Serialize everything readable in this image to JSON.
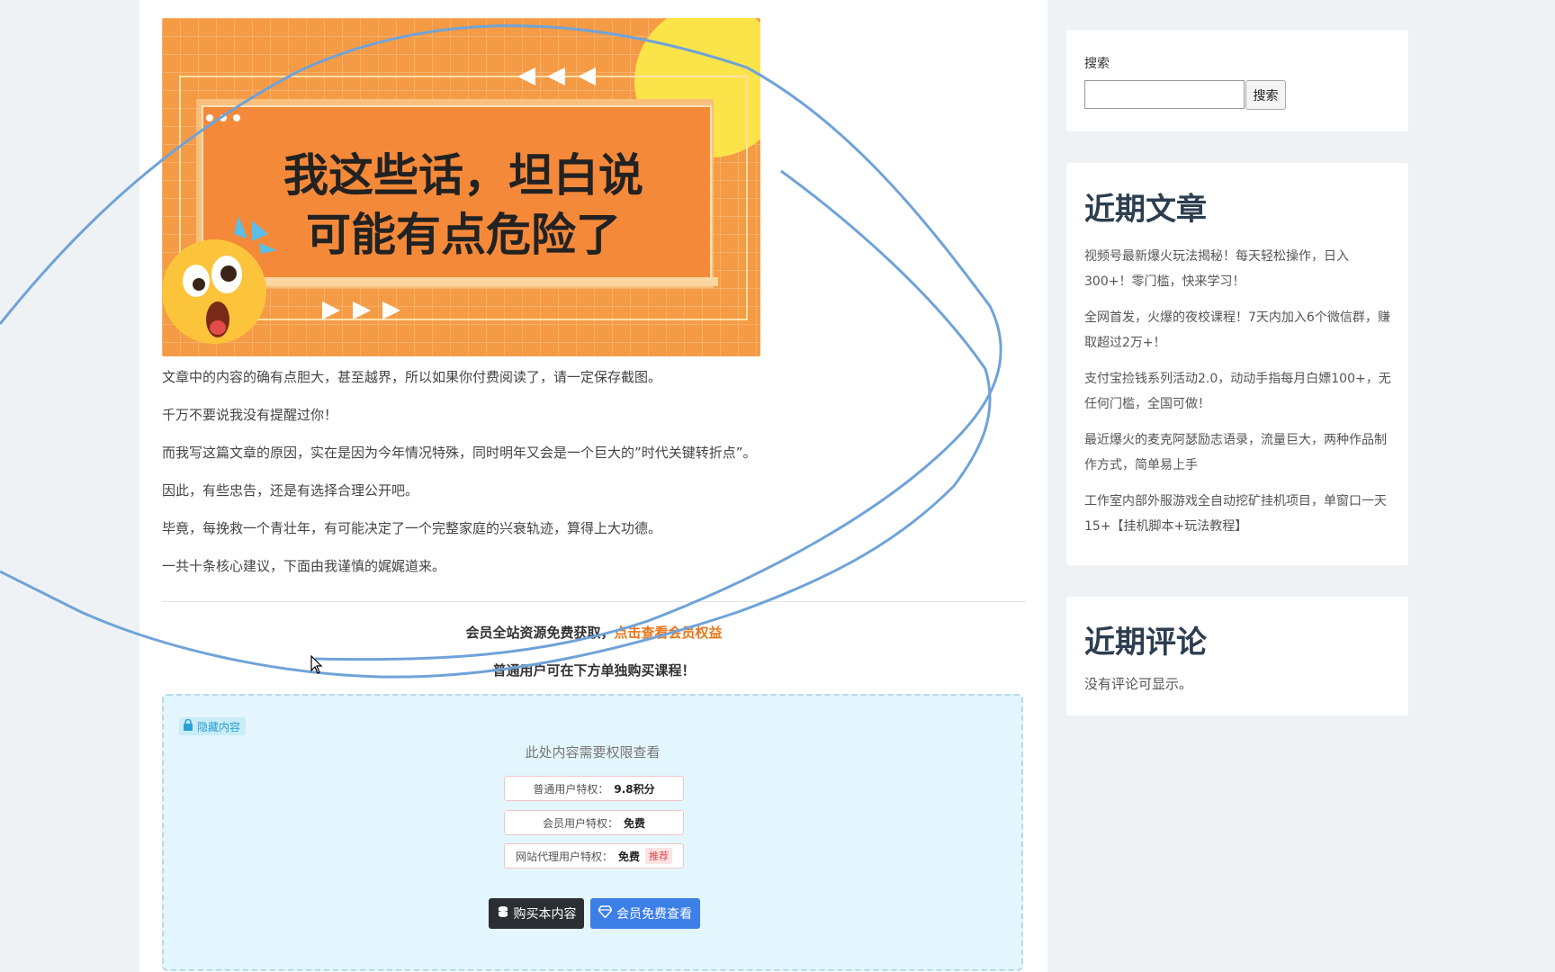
{
  "banner": {
    "line1": "我这些话，坦白说",
    "line2": "可能有点危险了"
  },
  "article": {
    "paragraphs": [
      "文章中的内容的确有点胆大，甚至越界，所以如果你付费阅读了，请一定保存截图。",
      "千万不要说我没有提醒过你！",
      "而我写这篇文章的原因，实在是因为今年情况特殊，同时明年又会是一个巨大的”时代关键转折点”。",
      "因此，有些忠告，还是有选择合理公开吧。",
      "毕竟，每挽救一个青壮年，有可能决定了一个完整家庭的兴衰轨迹，算得上大功德。",
      "一共十条核心建议，下面由我谨慎的娓娓道来。"
    ],
    "member_text": "会员全站资源免费获取，",
    "member_link": "点击查看会员权益",
    "buy_text": "普通用户可在下方单独购买课程！"
  },
  "hidden": {
    "tag": "隐藏内容",
    "desc": "此处内容需要权限查看",
    "privileges": [
      {
        "label": "普通用户特权：",
        "value": "9.8积分"
      },
      {
        "label": "会员用户特权：",
        "value": "免费"
      },
      {
        "label": "网站代理用户特权：",
        "value": "免费",
        "badge": "推荐"
      }
    ],
    "buy_button": "购买本内容",
    "vip_button": "会员免费查看"
  },
  "sidebar": {
    "search_label": "搜索",
    "search_value": "",
    "search_button": "搜索",
    "recent_title": "近期文章",
    "recent_posts": [
      "视频号最新爆火玩法揭秘！每天轻松操作，日入300+！零门槛，快来学习！",
      "全网首发，火爆的夜校课程！7天内加入6个微信群，赚取超过2万+！",
      "支付宝捡钱系列活动2.0，动动手指每月白嫖100+，无任何门槛，全国可做！",
      "最近爆火的麦克阿瑟励志语录，流量巨大，两种作品制作方式，简单易上手",
      "工作室内部外服游戏全自动挖矿挂机项目，单窗口一天15+【挂机脚本+玩法教程】"
    ],
    "comments_title": "近期评论",
    "no_comments": "没有评论可显示。"
  },
  "colors": {
    "banner_orange": "#f59b45",
    "link_orange": "#e8751a",
    "vip_blue": "#3c7fe7",
    "scribble_blue": "#6fa3d8"
  }
}
